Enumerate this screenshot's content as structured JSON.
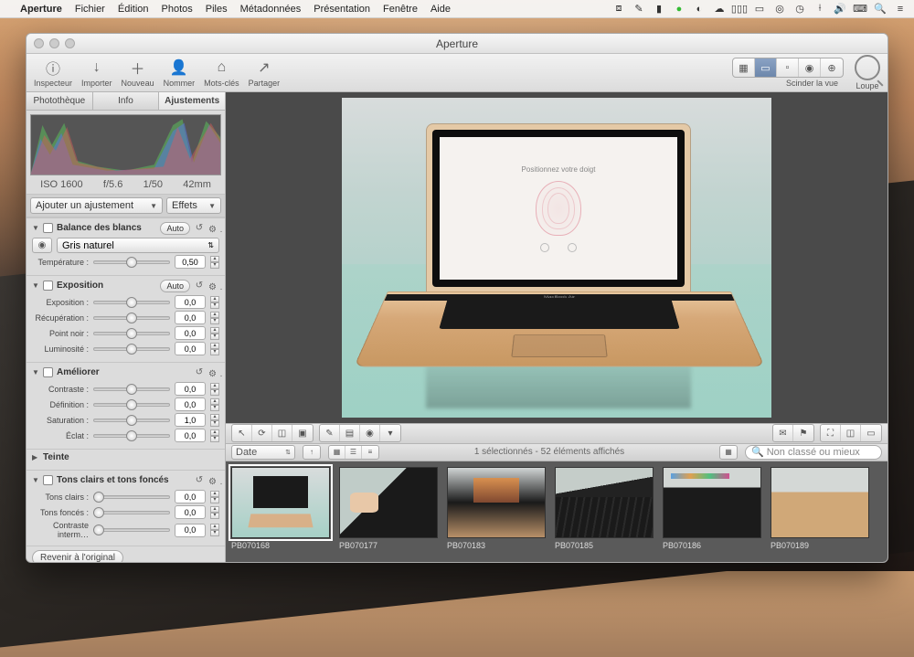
{
  "menubar": {
    "app": "Aperture",
    "items": [
      "Fichier",
      "Édition",
      "Photos",
      "Piles",
      "Métadonnées",
      "Présentation",
      "Fenêtre",
      "Aide"
    ]
  },
  "window": {
    "title": "Aperture"
  },
  "toolbar": {
    "buttons": [
      {
        "id": "inspector",
        "label": "Inspecteur",
        "glyph": "ⓘ"
      },
      {
        "id": "import",
        "label": "Importer",
        "glyph": "↓"
      },
      {
        "id": "new",
        "label": "Nouveau",
        "glyph": "＋"
      },
      {
        "id": "name",
        "label": "Nommer",
        "glyph": "👤"
      },
      {
        "id": "keywords",
        "label": "Mots-clés",
        "glyph": "⌂"
      },
      {
        "id": "share",
        "label": "Partager",
        "glyph": "↗"
      }
    ],
    "split_label": "Scinder la vue",
    "loupe_label": "Loupe"
  },
  "inspector": {
    "tabs": [
      "Photothèque",
      "Info",
      "Ajustements"
    ],
    "active_tab": 2,
    "histogram_meta": [
      "ISO 1600",
      "f/5.6",
      "1/50",
      "42mm"
    ],
    "add_adjustment": "Ajouter un ajustement",
    "effects": "Effets",
    "panels": {
      "white_balance": {
        "name": "Balance des blancs",
        "auto": "Auto",
        "preset": "Gris naturel",
        "temperature_label": "Température :",
        "temperature_value": "0,50"
      },
      "exposure": {
        "name": "Exposition",
        "auto": "Auto",
        "rows": [
          {
            "label": "Exposition :",
            "value": "0,0"
          },
          {
            "label": "Récupération :",
            "value": "0,0"
          },
          {
            "label": "Point noir :",
            "value": "0,0"
          },
          {
            "label": "Luminosité :",
            "value": "0,0"
          }
        ]
      },
      "enhance": {
        "name": "Améliorer",
        "rows": [
          {
            "label": "Contraste :",
            "value": "0,0"
          },
          {
            "label": "Définition :",
            "value": "0,0"
          },
          {
            "label": "Saturation :",
            "value": "1,0"
          },
          {
            "label": "Éclat :",
            "value": "0,0"
          }
        ]
      },
      "tint": {
        "name": "Teinte"
      },
      "highlights_shadows": {
        "name": "Tons clairs et tons foncés",
        "rows": [
          {
            "label": "Tons clairs :",
            "value": "0,0"
          },
          {
            "label": "Tons foncés :",
            "value": "0,0"
          },
          {
            "label": "Contraste interm…",
            "value": "0,0"
          }
        ]
      }
    },
    "revert": "Revenir à l'original"
  },
  "viewer_photo": {
    "screen_text": "Positionnez votre doigt",
    "hinge_text": "MacBook Air"
  },
  "filter_bar": {
    "date_label": "Date",
    "status": "1 sélectionnés - 52 éléments affichés",
    "search_placeholder": "Non classé ou mieux"
  },
  "thumbnails": [
    {
      "id": "PB070168",
      "selected": true,
      "cls": "th1"
    },
    {
      "id": "PB070177",
      "selected": false,
      "cls": "th2"
    },
    {
      "id": "PB070183",
      "selected": false,
      "cls": "th3"
    },
    {
      "id": "PB070185",
      "selected": false,
      "cls": "th4"
    },
    {
      "id": "PB070186",
      "selected": false,
      "cls": "th5"
    },
    {
      "id": "PB070189",
      "selected": false,
      "cls": "th6"
    }
  ]
}
